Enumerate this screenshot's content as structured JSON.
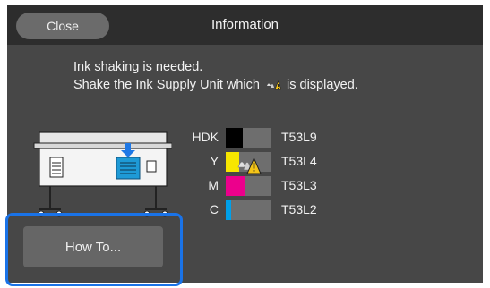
{
  "header": {
    "close_label": "Close",
    "title": "Information"
  },
  "message": {
    "line1": "Ink shaking is needed.",
    "line2_before": "Shake the Ink Supply Unit which",
    "line2_after": "is displayed."
  },
  "inks": [
    {
      "name": "HDK",
      "code": "T53L9",
      "color": "#000000",
      "level": 0.38,
      "warning": false
    },
    {
      "name": "Y",
      "code": "T53L4",
      "color": "#f7e600",
      "level": 0.3,
      "warning": true
    },
    {
      "name": "M",
      "code": "T53L3",
      "color": "#ec008c",
      "level": 0.42,
      "warning": false
    },
    {
      "name": "C",
      "code": "T53L2",
      "color": "#00a0e9",
      "level": 0.12,
      "warning": false
    }
  ],
  "footer": {
    "howto_label": "How To..."
  },
  "colors": {
    "highlight": "#1a73e8",
    "warning": "#f5c518",
    "arrow": "#1e78e6",
    "unit": "#1e9ad6"
  }
}
